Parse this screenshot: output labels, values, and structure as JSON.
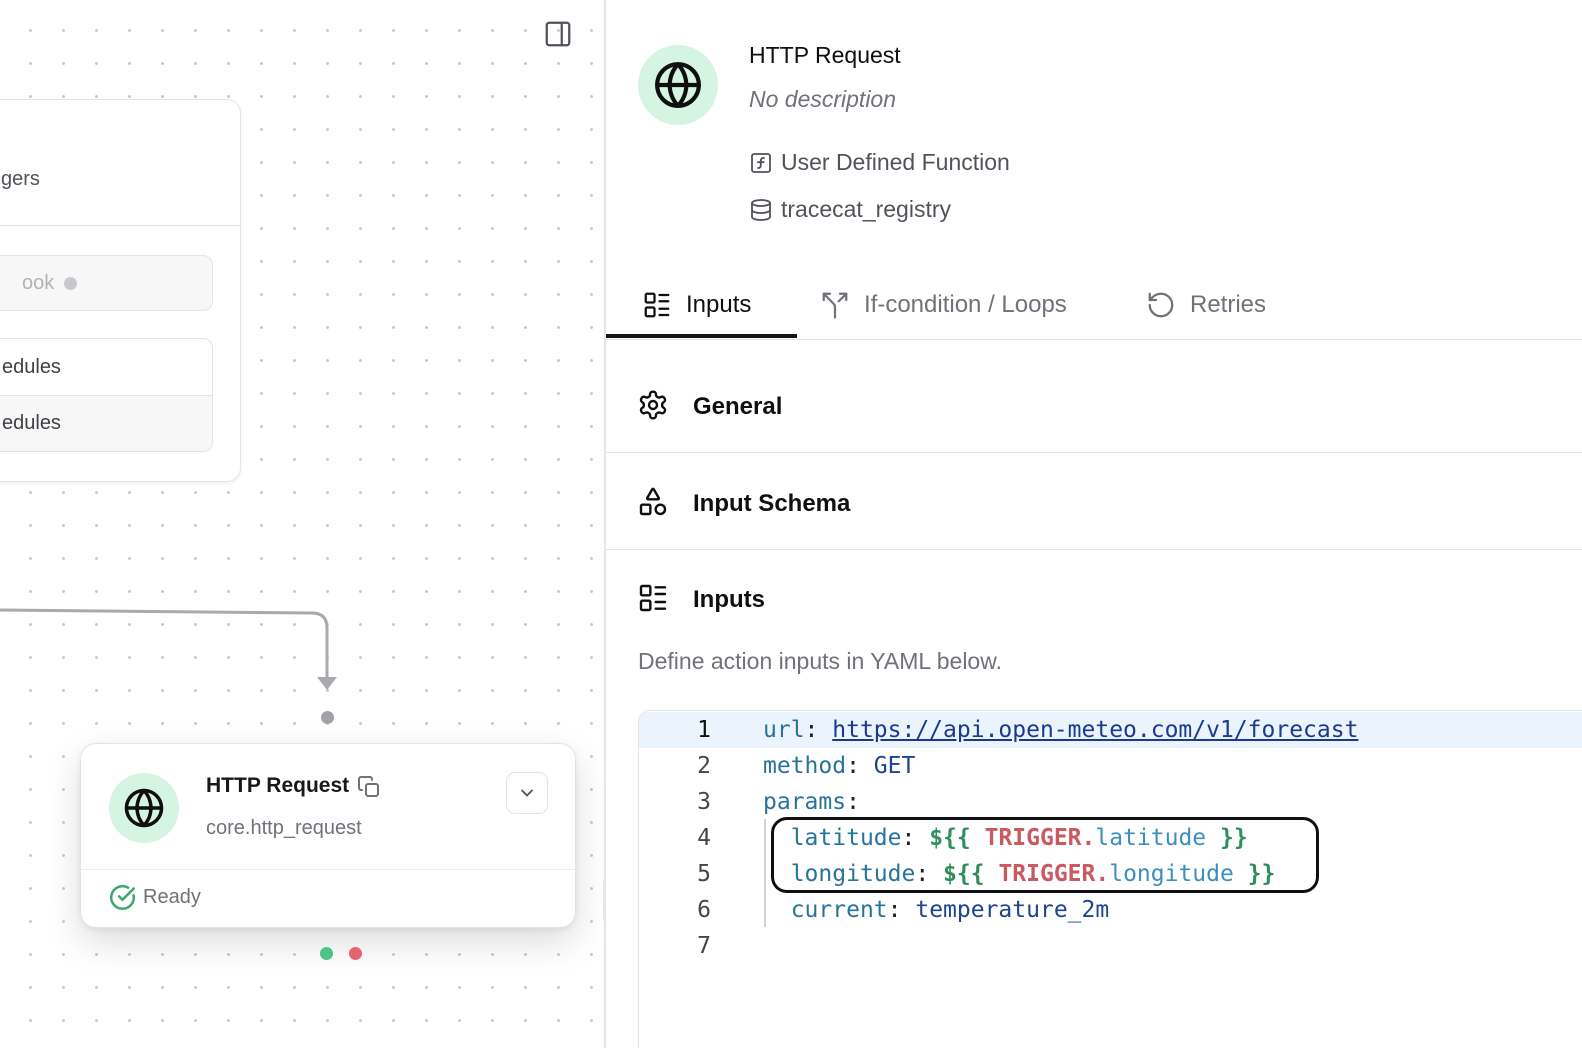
{
  "canvas": {
    "trigger_node": {
      "subtitle_fragment": "gers",
      "webhook_fragment": "ook",
      "schedule_rows": [
        "edules",
        "edules"
      ]
    },
    "action_node": {
      "title": "HTTP Request",
      "subtitle": "core.http_request",
      "status": "Ready",
      "icon": "globe-icon"
    },
    "colors": {
      "success_handle": "#4cc38a",
      "error_handle": "#e5646e",
      "target_handle": "#a1a1aa"
    }
  },
  "panel": {
    "title": "HTTP Request",
    "description": "No description",
    "type_label": "User Defined Function",
    "registry": "tracecat_registry",
    "tabs": [
      {
        "label": "Inputs",
        "icon": "list-icon",
        "active": true
      },
      {
        "label": "If-condition / Loops",
        "icon": "split-icon",
        "active": false
      },
      {
        "label": "Retries",
        "icon": "rotate-icon",
        "active": false
      }
    ],
    "sections": {
      "general": "General",
      "input_schema": "Input Schema",
      "inputs": "Inputs"
    },
    "inputs_hint": "Define action inputs in YAML below.",
    "editor": {
      "line_numbers": [
        "1",
        "2",
        "3",
        "4",
        "5",
        "6",
        "7"
      ],
      "url_key": "url",
      "url_value": "https://api.open-meteo.com/v1/forecast",
      "method_key": "method",
      "method_value": "GET",
      "params_key": "params",
      "latitude_key": "latitude",
      "latitude_open": "${{",
      "latitude_trigger": "TRIGGER.",
      "latitude_attr": "latitude",
      "latitude_close": "}}",
      "longitude_key": "longitude",
      "longitude_open": "${{",
      "longitude_trigger": "TRIGGER.",
      "longitude_attr": "longitude",
      "longitude_close": "}}",
      "current_key": "current",
      "current_value": "temperature_2m"
    }
  }
}
